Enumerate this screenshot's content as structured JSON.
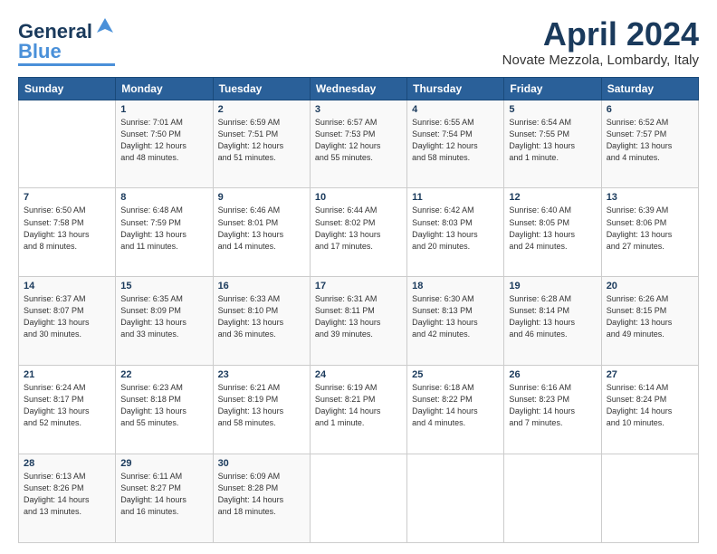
{
  "logo": {
    "line1": "General",
    "line2": "Blue"
  },
  "header": {
    "title": "April 2024",
    "location": "Novate Mezzola, Lombardy, Italy"
  },
  "days_of_week": [
    "Sunday",
    "Monday",
    "Tuesday",
    "Wednesday",
    "Thursday",
    "Friday",
    "Saturday"
  ],
  "weeks": [
    [
      {
        "day": "",
        "info": ""
      },
      {
        "day": "1",
        "info": "Sunrise: 7:01 AM\nSunset: 7:50 PM\nDaylight: 12 hours\nand 48 minutes."
      },
      {
        "day": "2",
        "info": "Sunrise: 6:59 AM\nSunset: 7:51 PM\nDaylight: 12 hours\nand 51 minutes."
      },
      {
        "day": "3",
        "info": "Sunrise: 6:57 AM\nSunset: 7:53 PM\nDaylight: 12 hours\nand 55 minutes."
      },
      {
        "day": "4",
        "info": "Sunrise: 6:55 AM\nSunset: 7:54 PM\nDaylight: 12 hours\nand 58 minutes."
      },
      {
        "day": "5",
        "info": "Sunrise: 6:54 AM\nSunset: 7:55 PM\nDaylight: 13 hours\nand 1 minute."
      },
      {
        "day": "6",
        "info": "Sunrise: 6:52 AM\nSunset: 7:57 PM\nDaylight: 13 hours\nand 4 minutes."
      }
    ],
    [
      {
        "day": "7",
        "info": "Sunrise: 6:50 AM\nSunset: 7:58 PM\nDaylight: 13 hours\nand 8 minutes."
      },
      {
        "day": "8",
        "info": "Sunrise: 6:48 AM\nSunset: 7:59 PM\nDaylight: 13 hours\nand 11 minutes."
      },
      {
        "day": "9",
        "info": "Sunrise: 6:46 AM\nSunset: 8:01 PM\nDaylight: 13 hours\nand 14 minutes."
      },
      {
        "day": "10",
        "info": "Sunrise: 6:44 AM\nSunset: 8:02 PM\nDaylight: 13 hours\nand 17 minutes."
      },
      {
        "day": "11",
        "info": "Sunrise: 6:42 AM\nSunset: 8:03 PM\nDaylight: 13 hours\nand 20 minutes."
      },
      {
        "day": "12",
        "info": "Sunrise: 6:40 AM\nSunset: 8:05 PM\nDaylight: 13 hours\nand 24 minutes."
      },
      {
        "day": "13",
        "info": "Sunrise: 6:39 AM\nSunset: 8:06 PM\nDaylight: 13 hours\nand 27 minutes."
      }
    ],
    [
      {
        "day": "14",
        "info": "Sunrise: 6:37 AM\nSunset: 8:07 PM\nDaylight: 13 hours\nand 30 minutes."
      },
      {
        "day": "15",
        "info": "Sunrise: 6:35 AM\nSunset: 8:09 PM\nDaylight: 13 hours\nand 33 minutes."
      },
      {
        "day": "16",
        "info": "Sunrise: 6:33 AM\nSunset: 8:10 PM\nDaylight: 13 hours\nand 36 minutes."
      },
      {
        "day": "17",
        "info": "Sunrise: 6:31 AM\nSunset: 8:11 PM\nDaylight: 13 hours\nand 39 minutes."
      },
      {
        "day": "18",
        "info": "Sunrise: 6:30 AM\nSunset: 8:13 PM\nDaylight: 13 hours\nand 42 minutes."
      },
      {
        "day": "19",
        "info": "Sunrise: 6:28 AM\nSunset: 8:14 PM\nDaylight: 13 hours\nand 46 minutes."
      },
      {
        "day": "20",
        "info": "Sunrise: 6:26 AM\nSunset: 8:15 PM\nDaylight: 13 hours\nand 49 minutes."
      }
    ],
    [
      {
        "day": "21",
        "info": "Sunrise: 6:24 AM\nSunset: 8:17 PM\nDaylight: 13 hours\nand 52 minutes."
      },
      {
        "day": "22",
        "info": "Sunrise: 6:23 AM\nSunset: 8:18 PM\nDaylight: 13 hours\nand 55 minutes."
      },
      {
        "day": "23",
        "info": "Sunrise: 6:21 AM\nSunset: 8:19 PM\nDaylight: 13 hours\nand 58 minutes."
      },
      {
        "day": "24",
        "info": "Sunrise: 6:19 AM\nSunset: 8:21 PM\nDaylight: 14 hours\nand 1 minute."
      },
      {
        "day": "25",
        "info": "Sunrise: 6:18 AM\nSunset: 8:22 PM\nDaylight: 14 hours\nand 4 minutes."
      },
      {
        "day": "26",
        "info": "Sunrise: 6:16 AM\nSunset: 8:23 PM\nDaylight: 14 hours\nand 7 minutes."
      },
      {
        "day": "27",
        "info": "Sunrise: 6:14 AM\nSunset: 8:24 PM\nDaylight: 14 hours\nand 10 minutes."
      }
    ],
    [
      {
        "day": "28",
        "info": "Sunrise: 6:13 AM\nSunset: 8:26 PM\nDaylight: 14 hours\nand 13 minutes."
      },
      {
        "day": "29",
        "info": "Sunrise: 6:11 AM\nSunset: 8:27 PM\nDaylight: 14 hours\nand 16 minutes."
      },
      {
        "day": "30",
        "info": "Sunrise: 6:09 AM\nSunset: 8:28 PM\nDaylight: 14 hours\nand 18 minutes."
      },
      {
        "day": "",
        "info": ""
      },
      {
        "day": "",
        "info": ""
      },
      {
        "day": "",
        "info": ""
      },
      {
        "day": "",
        "info": ""
      }
    ]
  ]
}
